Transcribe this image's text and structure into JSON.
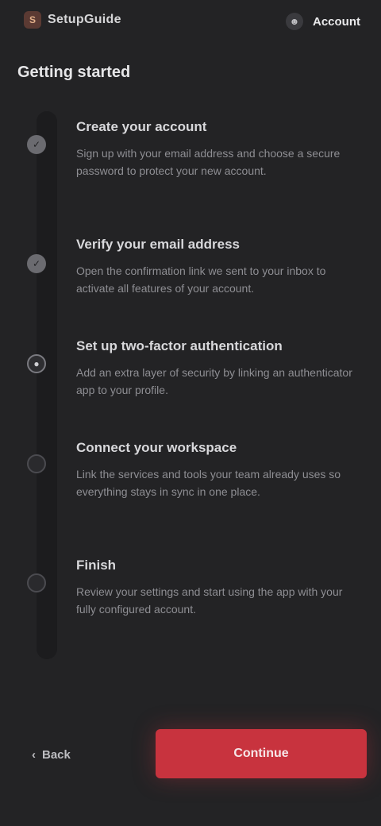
{
  "header": {
    "logo_mark": "S",
    "app_name": "SetupGuide",
    "account_icon": "user-icon",
    "account_name": "Account"
  },
  "page": {
    "title": "Getting started"
  },
  "steps": [
    {
      "title": "Create your account",
      "description": "Sign up with your email address and choose a secure password to protect your new account.",
      "status": "done",
      "icon": "check-icon"
    },
    {
      "title": "Verify your email address",
      "description": "Open the confirmation link we sent to your inbox to activate all features of your account.",
      "status": "done",
      "icon": "check-icon"
    },
    {
      "title": "Set up two-factor authentication",
      "description": "Add an extra layer of security by linking an authenticator app to your profile.",
      "status": "active",
      "icon": "dot-icon"
    },
    {
      "title": "Connect your workspace",
      "description": "Link the services and tools your team already uses so everything stays in sync in one place.",
      "status": "todo",
      "icon": "circle-icon"
    },
    {
      "title": "Finish",
      "description": "Review your settings and start using the app with your fully configured account.",
      "status": "todo",
      "icon": "circle-icon"
    }
  ],
  "footer": {
    "back_label": "Back",
    "continue_label": "Continue"
  },
  "colors": {
    "background": "#232325",
    "accent": "#c8333e"
  }
}
